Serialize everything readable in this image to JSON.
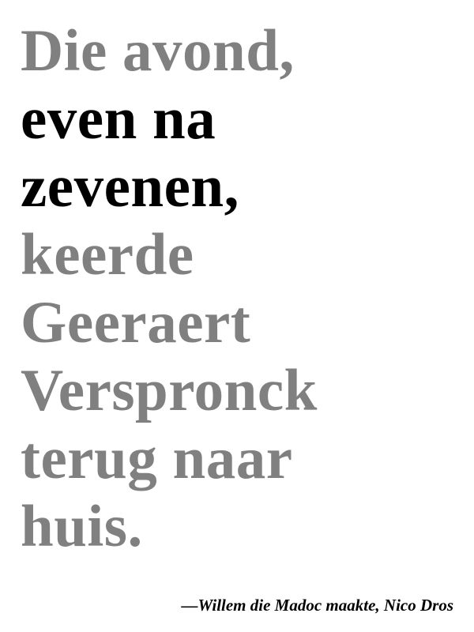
{
  "quote": {
    "lines": [
      {
        "text": "Die avond,",
        "emphasis": false
      },
      {
        "text": "even na",
        "emphasis": true
      },
      {
        "text": "zevenen,",
        "emphasis": true
      },
      {
        "text": "keerde",
        "emphasis": false
      },
      {
        "text": "Geeraert",
        "emphasis": false
      },
      {
        "text": "Verspronck",
        "emphasis": false
      },
      {
        "text": "terug naar",
        "emphasis": false
      },
      {
        "text": "huis.",
        "emphasis": false
      }
    ]
  },
  "attribution": "—Willem die Madoc maakte, Nico Dros",
  "colors": {
    "muted_text": "#808080",
    "emphasis_text": "#000000",
    "background": "#ffffff"
  }
}
